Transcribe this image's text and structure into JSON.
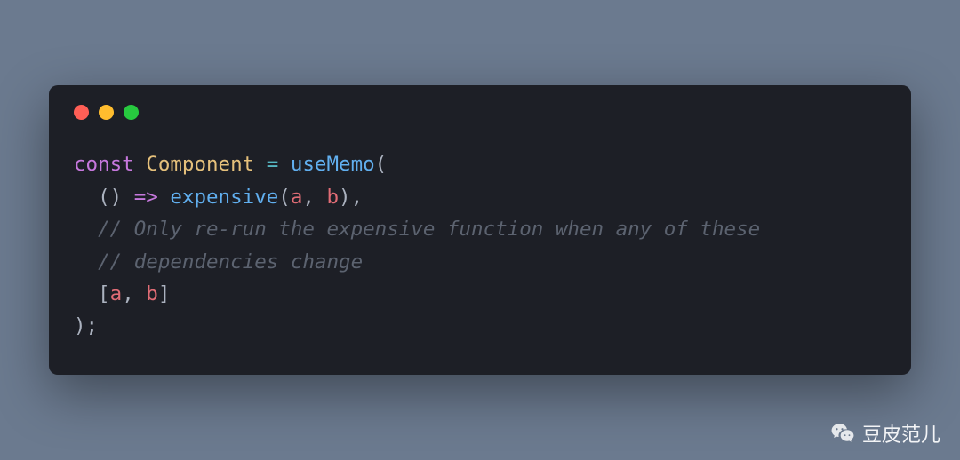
{
  "window": {
    "traffic_lights": [
      "red",
      "yellow",
      "green"
    ]
  },
  "code": {
    "line1": {
      "keyword": "const",
      "space1": " ",
      "class_name": "Component",
      "space2": " ",
      "eq": "=",
      "space3": " ",
      "func": "useMemo",
      "open": "("
    },
    "line2": {
      "indent": "  ",
      "paren_open": "(",
      "paren_close": ")",
      "space1": " ",
      "arrow": "=>",
      "space2": " ",
      "call": "expensive",
      "args_open": "(",
      "arg_a": "a",
      "comma1": ", ",
      "arg_b": "b",
      "args_close": ")",
      "trailing_comma": ","
    },
    "line3": {
      "indent": "  ",
      "comment": "// Only re-run the expensive function when any of these"
    },
    "line4": {
      "indent": "  ",
      "comment": "// dependencies change"
    },
    "line5": {
      "indent": "  ",
      "bracket_open": "[",
      "a": "a",
      "comma": ", ",
      "b": "b",
      "bracket_close": "]"
    },
    "line6": {
      "close": ")",
      "semi": ";"
    }
  },
  "watermark": {
    "text": "豆皮范儿",
    "icon": "wechat-icon"
  }
}
